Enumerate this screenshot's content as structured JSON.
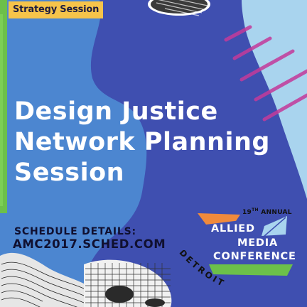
{
  "badge": {
    "label": "Strategy Session"
  },
  "title": {
    "line1": "Design Justice",
    "line2": "Network Planning",
    "line3": "Session"
  },
  "schedule": {
    "label": "SCHEDULE DETAILS:",
    "url": "AMC2017.SCHED.COM"
  },
  "logo": {
    "edition_number": "19",
    "edition_suffix": "TH",
    "edition_label": "ANNUAL",
    "word1": "ALLIED",
    "word2": "MEDIA",
    "word3": "CONFERENCE",
    "city": "DETROIT"
  },
  "colors": {
    "background": "#3f4fb0",
    "mid_blue": "#4c86d0",
    "light_blue": "#a9d4ee",
    "accent_green": "#6cc04a",
    "accent_yellow": "#f6c44a",
    "accent_orange": "#f08a3c",
    "accent_magenta": "#c43a9a"
  }
}
